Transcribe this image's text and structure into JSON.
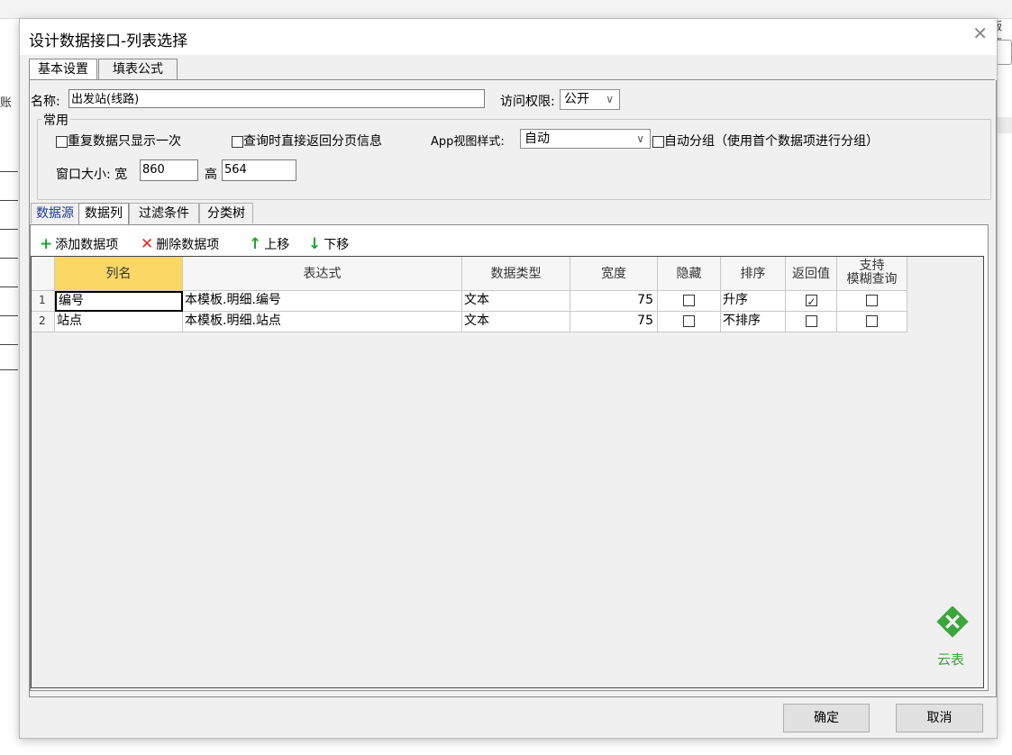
{
  "background": {
    "side_char": "账",
    "right_text": "版本"
  },
  "dialog": {
    "title": "设计数据接口-列表选择",
    "tabs": [
      "基本设置",
      "填表公式"
    ],
    "name_label": "名称:",
    "name_value": "出发站(线路)",
    "access_label": "访问权限:",
    "access_value": "公开",
    "group_title": "常用",
    "opt_repeat": "重复数据只显示一次",
    "opt_paging": "查询时直接返回分页信息",
    "app_style_label": "App视图样式:",
    "app_style_value": "自动",
    "opt_autogroup": "自动分组（使用首个数据项进行分组）",
    "size_label": "窗口大小: 宽",
    "width_value": "860",
    "height_label": "高",
    "height_value": "564",
    "subtabs": [
      "数据源",
      "数据列",
      "过滤条件",
      "分类树"
    ],
    "toolbar": {
      "add": "添加数据项",
      "delete": "删除数据项",
      "up": "上移",
      "down": "下移"
    },
    "grid": {
      "headers": [
        "列名",
        "表达式",
        "数据类型",
        "宽度",
        "隐藏",
        "排序",
        "返回值",
        "支持",
        "模糊查询"
      ],
      "rows": [
        {
          "n": "1",
          "name": "编号",
          "expr": "本模板.明细.编号",
          "type": "文本",
          "width": "75",
          "hidden": false,
          "sort": "升序",
          "ret": true,
          "fuzzy": false
        },
        {
          "n": "2",
          "name": "站点",
          "expr": "本模板.明细.站点",
          "type": "文本",
          "width": "75",
          "hidden": false,
          "sort": "不排序",
          "ret": false,
          "fuzzy": false
        }
      ]
    },
    "logo_text": "云表",
    "ok": "确定",
    "cancel": "取消",
    "colors": {
      "header_highlight": "#fbd766",
      "add_icon": "#1fa32e",
      "delete_icon": "#e0241b",
      "logo": "#3aa53a"
    }
  }
}
